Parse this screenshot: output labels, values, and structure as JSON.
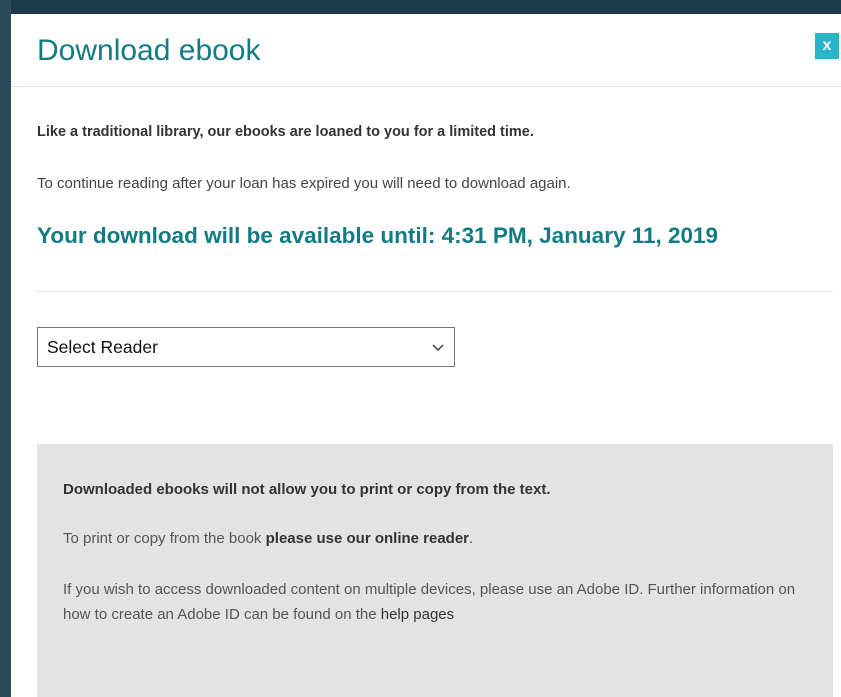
{
  "modal": {
    "title": "Download ebook",
    "close_label": "x"
  },
  "intro": {
    "bold_line": "Like a traditional library, our ebooks are loaned to you for a limited time.",
    "plain_line": "To continue reading after your loan has expired you will need to download again."
  },
  "availability": {
    "text": "Your download will be available until: 4:31 PM, January 11, 2019"
  },
  "reader_select": {
    "selected": "Select Reader"
  },
  "info": {
    "bold_line": "Downloaded ebooks will not allow you to print or copy from the text.",
    "print_prefix": "To print or copy from the book ",
    "print_link": "please use our online reader",
    "print_suffix": ".",
    "adobe_text": "If you wish to access downloaded content on multiple devices, please use an Adobe ID. Further information on how to create an Adobe ID can be found on the ",
    "help_link": "help pages"
  },
  "colors": {
    "accent": "#137b83",
    "close_button": "#29b4c8",
    "info_background": "#e3e3e3"
  },
  "icons": {
    "select_arrow": "chevron-down-icon"
  }
}
